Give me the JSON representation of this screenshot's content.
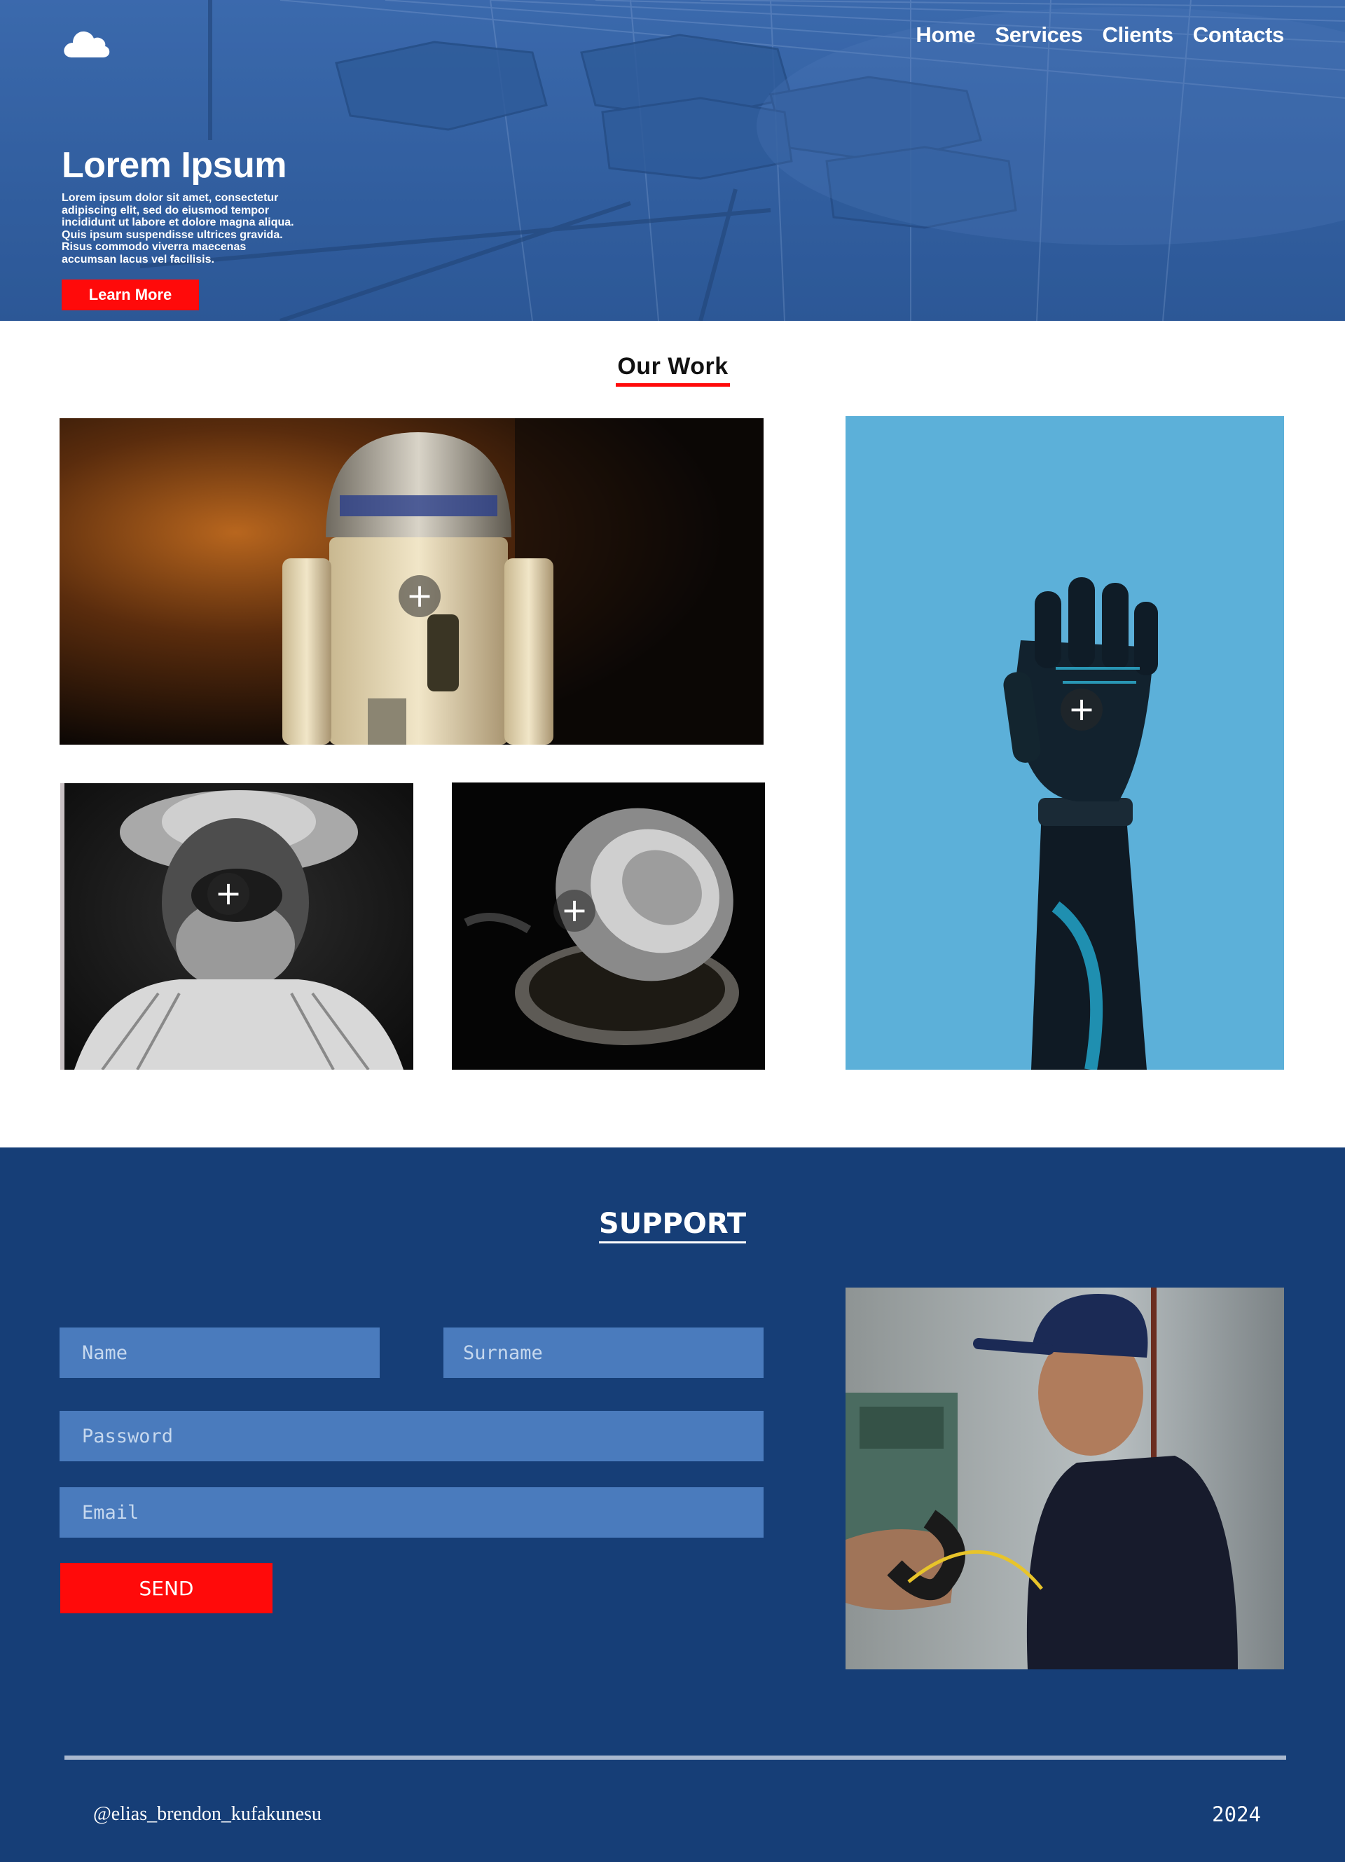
{
  "header": {
    "logo": "cloud-icon",
    "nav": [
      {
        "label": "Home"
      },
      {
        "label": "Services"
      },
      {
        "label": "Clients"
      },
      {
        "label": "Contacts"
      }
    ]
  },
  "hero": {
    "title": "Lorem Ipsum",
    "lines": [
      "Lorem ipsum dolor sit amet, consectetur",
      "adipiscing elit, sed do eiusmod tempor",
      "incididunt ut labore et dolore magna aliqua.",
      "Quis ipsum suspendisse ultrices gravida.",
      "Risus commodo viverra maecenas",
      "accumsan lacus vel facilisis."
    ],
    "button_label": "Learn More"
  },
  "work": {
    "title": "Our Work",
    "items": [
      {
        "subject": "robot toy",
        "plus": "+"
      },
      {
        "subject": "laughing man",
        "plus": "+"
      },
      {
        "subject": "pocket watch",
        "plus": "+"
      },
      {
        "subject": "robotic hand",
        "plus": "+"
      }
    ]
  },
  "support": {
    "title": "SUPPORT",
    "fields": {
      "name": "Name",
      "surname": "Surname",
      "password": "Password",
      "email": "Email"
    },
    "send_label": "SEND"
  },
  "footer": {
    "handle": "@elias_brendon_kufakunesu",
    "year": "2024"
  },
  "colors": {
    "hero_blue": "#3f6db0",
    "support_bg": "#163e77",
    "field_bg": "#4a7bbd",
    "accent_red": "#ff0a0a"
  }
}
